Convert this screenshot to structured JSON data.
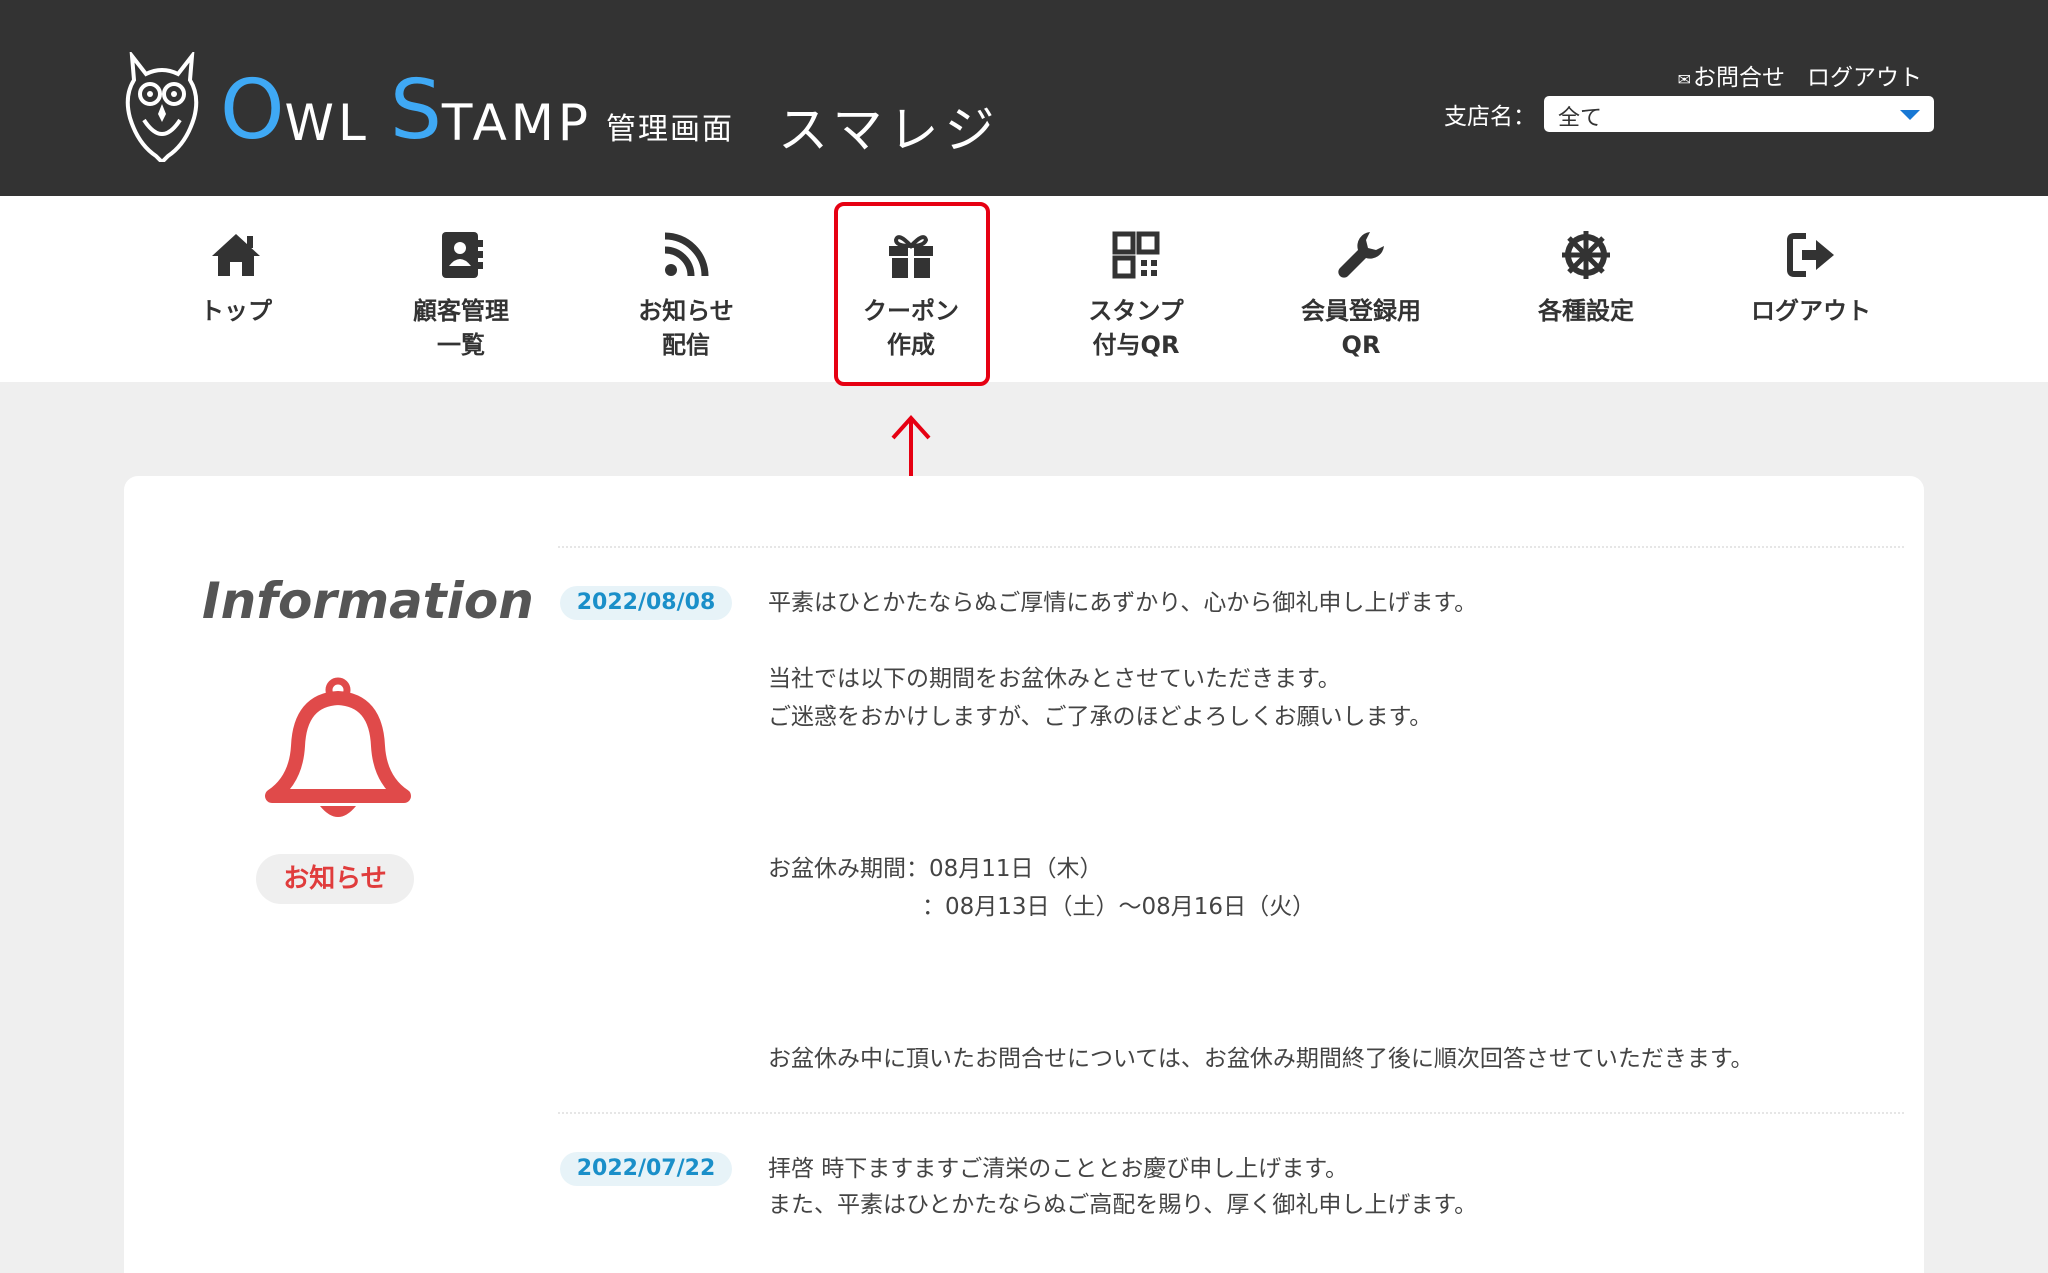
{
  "header": {
    "logo": {
      "o_big": "O",
      "o_rest": "WL",
      "s_big": "S",
      "s_rest": "TAMP",
      "sub": "管理画面",
      "brand": "スマレジ"
    },
    "links": {
      "contact": "お問合せ",
      "logout": "ログアウト"
    },
    "branch": {
      "label": "支店名：",
      "selected": "全て"
    }
  },
  "nav": {
    "items": [
      {
        "label": "トップ",
        "icon": "home-icon"
      },
      {
        "label": "顧客管理\n一覧",
        "icon": "address-book-icon"
      },
      {
        "label": "お知らせ\n配信",
        "icon": "rss-icon"
      },
      {
        "label": "クーポン\n作成",
        "icon": "gift-icon"
      },
      {
        "label": "スタンプ\n付与QR",
        "icon": "qr-code-icon"
      },
      {
        "label": "会員登録用\nQR",
        "icon": "wrench-icon"
      },
      {
        "label": "各種設定",
        "icon": "settings-wheel-icon"
      },
      {
        "label": "ログアウト",
        "icon": "sign-out-icon"
      }
    ]
  },
  "colors": {
    "header_bg": "#333333",
    "accent_blue": "#3fa9f5",
    "highlight_red": "#e60012",
    "bell_red": "#e04a4a"
  },
  "info": {
    "title": "Information",
    "badge": "お知らせ",
    "posts": [
      {
        "date": "2022/08/08",
        "lines": [
          "平素はひとかたならぬご厚情にあずかり、心から御礼申し上げます。",
          "当社では以下の期間をお盆休みとさせていただきます。",
          "ご迷惑をおかけしますが、ご了承のほどよろしくお願いします。",
          "お盆休み期間：08月11日（木）",
          "：08月13日（土）〜08月16日（火）",
          "お盆休み中に頂いたお問合せについては、お盆休み期間終了後に順次回答させていただきます。"
        ]
      },
      {
        "date": "2022/07/22",
        "lines": [
          "拝啓 時下ますますご清栄のこととお慶び申し上げます。",
          "また、平素はひとかたならぬご高配を賜り、厚く御礼申し上げます。"
        ]
      }
    ]
  }
}
